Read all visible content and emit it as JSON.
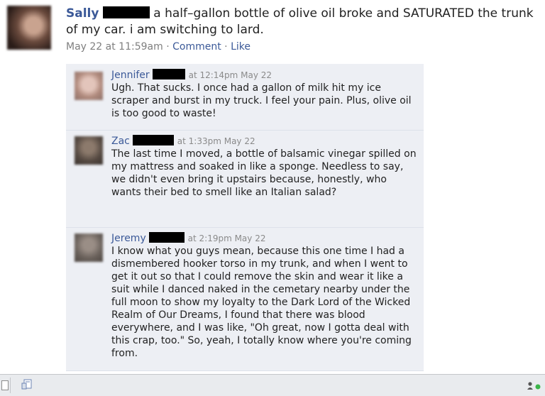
{
  "post": {
    "author": "Sally",
    "message": "a half–gallon bottle of olive oil broke and SATURATED the trunk of my car. i am switching to lard.",
    "timestamp": "May 22 at 11:59am",
    "separator": "·",
    "comment_link": "Comment",
    "like_link": "Like"
  },
  "comments": [
    {
      "author": "Jennifer",
      "time": "at 12:14pm May 22",
      "body": "Ugh. That sucks. I once had a gallon of milk hit my ice scraper and burst in my truck. I feel your pain. Plus, olive oil is too good to waste!"
    },
    {
      "author": "Zac",
      "time": "at 1:33pm May 22",
      "body": "The last time I moved, a bottle of balsamic vinegar spilled on my mattress and soaked in like a sponge. Needless to say, we didn't even bring it upstairs because, honestly, who wants their bed to smell like an Italian salad?"
    },
    {
      "author": "Jeremy",
      "time": "at 2:19pm May 22",
      "body": "I know what you guys mean, because this one time I had a dismembered hooker torso in my trunk, and when I went to get it out so that I could remove the skin and wear it like a suit while I danced naked in the cemetary nearby under the full moon to show my loyalty to the Dark Lord of the Wicked Realm of Our Dreams, I found that there was blood everywhere, and I was like, \"Oh great, now I gotta deal with this crap, too.\" So, yeah, I totally know where you're coming from."
    }
  ],
  "bottom_bar": {
    "icons": [
      "window-icon",
      "notes-icon",
      "online-friends-icon"
    ]
  },
  "colors": {
    "link": "#3b5998",
    "comment_bg": "#edeff4",
    "meta_text": "#7f7f7f",
    "online_dot": "#3bb54a"
  }
}
